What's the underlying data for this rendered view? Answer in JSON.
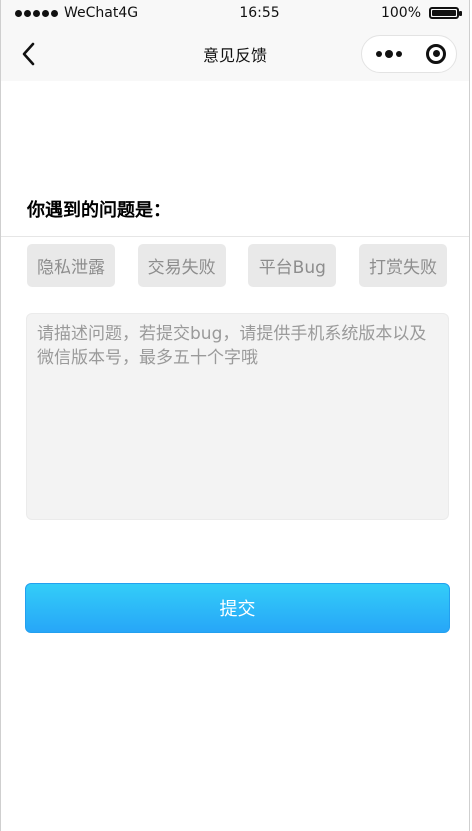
{
  "status_bar": {
    "carrier": "WeChat4G",
    "time": "16:55",
    "battery_text": "100%",
    "battery_level": 1.0
  },
  "nav": {
    "title": "意见反馈",
    "back_icon": "chevron-left-icon",
    "more_icon": "more-dots-icon",
    "close_icon": "target-close-icon"
  },
  "form": {
    "question_title": "你遇到的问题是：",
    "tags": [
      "隐私泄露",
      "交易失败",
      "平台Bug",
      "打赏失败"
    ],
    "textarea_placeholder": "请描述问题，若提交bug，请提供手机系统版本以及微信版本号，最多五十个字哦",
    "submit_label": "提交"
  },
  "colors": {
    "submit_gradient_top": "#33cdf8",
    "submit_gradient_bottom": "#27a6f8",
    "tag_bg": "#e9e9e9",
    "tag_text": "#8d8d8d"
  }
}
